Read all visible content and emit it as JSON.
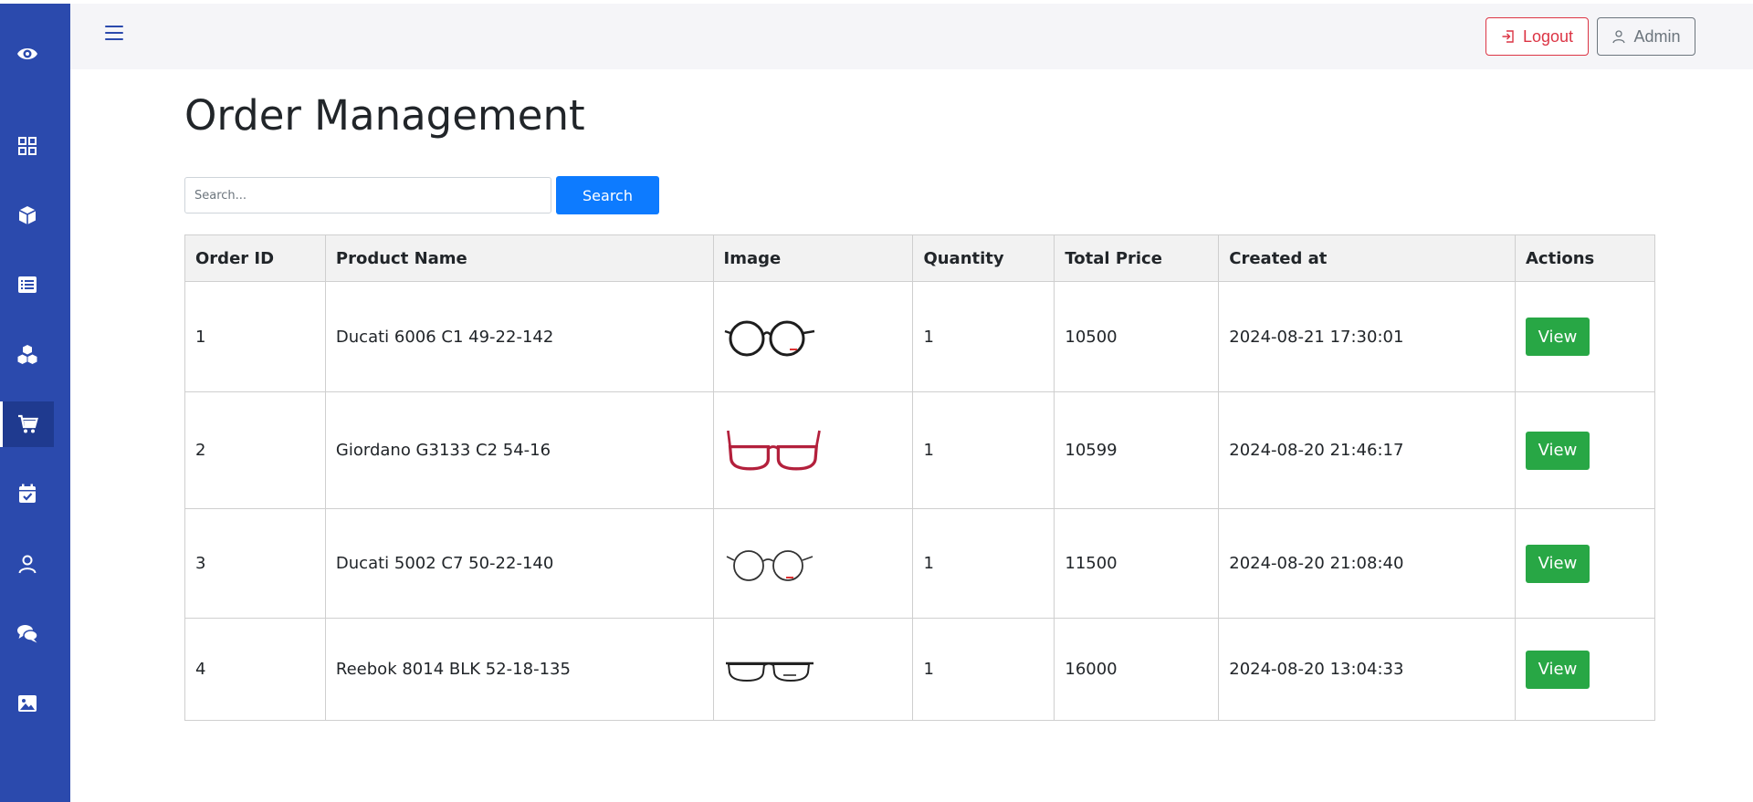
{
  "sidebar": {
    "icons": [
      "eye-icon",
      "dashboard-icon",
      "box-icon",
      "list-icon",
      "cubes-icon",
      "cart-icon",
      "calendar-check-icon",
      "user-icon",
      "comments-icon",
      "image-icon"
    ],
    "active": "cart-icon"
  },
  "header": {
    "logout_label": "Logout",
    "admin_label": "Admin"
  },
  "main": {
    "title": "Order Management",
    "search": {
      "placeholder": "Search...",
      "button_label": "Search"
    },
    "columns": [
      "Order ID",
      "Product Name",
      "Image",
      "Quantity",
      "Total Price",
      "Created at",
      "Actions"
    ],
    "rows": [
      {
        "id": "1",
        "product": "Ducati 6006 C1 49-22-142",
        "image": "round-black-glasses",
        "qty": "1",
        "price": "10500",
        "created": "2024-08-21 17:30:01",
        "action": "View"
      },
      {
        "id": "2",
        "product": "Giordano G3133 C2 54-16",
        "image": "rectangular-red-glasses",
        "qty": "1",
        "price": "10599",
        "created": "2024-08-20 21:46:17",
        "action": "View"
      },
      {
        "id": "3",
        "product": "Ducati 5002 C7 50-22-140",
        "image": "round-thin-glasses",
        "qty": "1",
        "price": "11500",
        "created": "2024-08-20 21:08:40",
        "action": "View"
      },
      {
        "id": "4",
        "product": "Reebok 8014 BLK 52-18-135",
        "image": "rectangular-black-glasses",
        "qty": "1",
        "price": "16000",
        "created": "2024-08-20 13:04:33",
        "action": "View"
      }
    ]
  },
  "colors": {
    "sidebar": "#2b4aad",
    "primary": "#0d7bff",
    "success": "#28a745",
    "danger": "#dc3545",
    "secondary": "#6c757d"
  }
}
